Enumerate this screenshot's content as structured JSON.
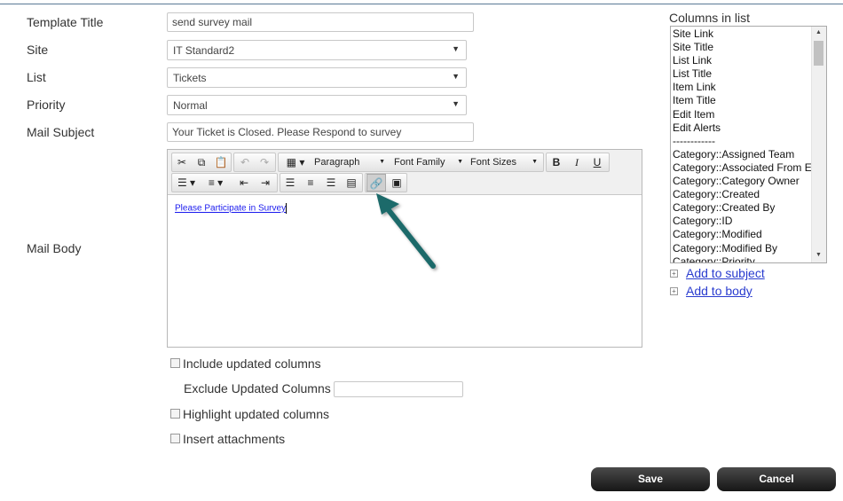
{
  "form": {
    "template_title_label": "Template Title",
    "template_title_value": "send survey mail",
    "site_label": "Site",
    "site_value": "IT Standard2",
    "list_label": "List",
    "list_value": "Tickets",
    "priority_label": "Priority",
    "priority_value": "Normal",
    "mail_subject_label": "Mail Subject",
    "mail_subject_value": "Your Ticket is Closed. Please Respond to survey",
    "mail_body_label": "Mail Body"
  },
  "editor": {
    "format_select": "Paragraph",
    "font_family_select": "Font Family",
    "font_size_select": "Font Sizes",
    "bold": "B",
    "italic": "I",
    "underline": "U",
    "body_link_text": "Please Participate in Survey"
  },
  "options": {
    "include_updated": "Include updated columns",
    "exclude_updated_label": "Exclude Updated Columns",
    "exclude_updated_value": "",
    "highlight_updated": "Highlight updated columns",
    "insert_attachments": "Insert attachments"
  },
  "columns": {
    "title": "Columns in list",
    "items": [
      "Site Link",
      "Site Title",
      "List Link",
      "List Title",
      "Item Link",
      "Item Title",
      "Edit Item",
      "Edit Alerts",
      "------------",
      "Category::Assigned Team",
      "Category::Associated From Email",
      "Category::Category Owner",
      "Category::Created",
      "Category::Created By",
      "Category::ID",
      "Category::Modified",
      "Category::Modified By",
      "Category::Priority"
    ],
    "add_to_subject": "Add to subject",
    "add_to_body": "Add to body"
  },
  "buttons": {
    "save": "Save",
    "cancel": "Cancel"
  },
  "colors": {
    "link": "#2a3ccf",
    "arrow": "#1f6b6b",
    "button_bg": "#222222"
  }
}
